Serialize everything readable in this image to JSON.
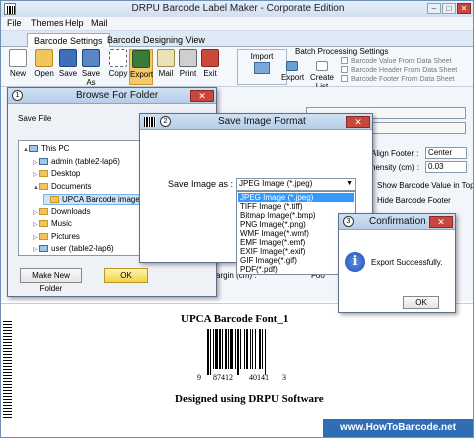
{
  "app": {
    "title": "DRPU Barcode Label Maker - Corporate Edition"
  },
  "menu": [
    "File",
    "Themes",
    "Help",
    "Mail"
  ],
  "tabs": [
    "Barcode Settings",
    "Barcode Designing View"
  ],
  "toolbar": [
    {
      "label": "New",
      "icon": "new-icon"
    },
    {
      "label": "Open",
      "icon": "open-icon"
    },
    {
      "label": "Save",
      "icon": "save-icon"
    },
    {
      "label": "Save As",
      "icon": "save-as-icon"
    },
    {
      "label": "Copy",
      "icon": "copy-icon"
    },
    {
      "label": "Export",
      "icon": "export-icon"
    },
    {
      "label": "Mail",
      "icon": "mail-icon"
    },
    {
      "label": "Print",
      "icon": "print-icon"
    },
    {
      "label": "Exit",
      "icon": "exit-icon"
    }
  ],
  "import": {
    "label": "Import",
    "export_label": "Export",
    "create_list_label": "Create List"
  },
  "batch": {
    "title": "Batch Processing Settings",
    "options": [
      "Barcode Value From Data Sheet",
      "Barcode Header From Data Sheet",
      "Barcode Footer From Data Sheet"
    ]
  },
  "side_fields": {
    "align_footer_label": "Align Footer :",
    "align_footer_value": "Center",
    "margin_label": "hensity (cm) :",
    "margin_value": "0.03",
    "show_value_label": "Show Barcode Value in Top",
    "hide_footer_label": "Hide Barcode Footer",
    "partial_label_1": "in",
    "partial_label_2": "argin (cm) :",
    "partial_label_3": "Foo"
  },
  "browse_dialog": {
    "badge": "1",
    "title": "Browse For Folder",
    "subtitle": "Save File",
    "tree": [
      {
        "label": "This PC",
        "type": "pc",
        "indent": 0,
        "arrow": "▲"
      },
      {
        "label": "admin (table2-lap6)",
        "type": "pc",
        "indent": 1,
        "arrow": "▷"
      },
      {
        "label": "Desktop",
        "type": "folder",
        "indent": 1,
        "arrow": "▷"
      },
      {
        "label": "Documents",
        "type": "folder",
        "indent": 1,
        "arrow": "▲"
      },
      {
        "label": "UPCA Barcode image",
        "type": "folder",
        "indent": 2,
        "arrow": "",
        "selected": true
      },
      {
        "label": "Downloads",
        "type": "folder",
        "indent": 1,
        "arrow": "▷"
      },
      {
        "label": "Music",
        "type": "folder",
        "indent": 1,
        "arrow": "▷"
      },
      {
        "label": "Pictures",
        "type": "folder",
        "indent": 1,
        "arrow": "▷"
      },
      {
        "label": "user (table2-lap6)",
        "type": "pc",
        "indent": 1,
        "arrow": "▷"
      }
    ],
    "new_folder_label": "Make New Folder",
    "ok_label": "OK"
  },
  "save_image_dialog": {
    "badge": "2",
    "title": "Save Image Format",
    "save_as_label": "Save Image as :",
    "selected": "JPEG Image (*.jpeg)",
    "options": [
      "JPEG Image (*.jpeg)",
      "TIFF Image (*.tiff)",
      "Bitmap Image(*.bmp)",
      "PNG Image(*.png)",
      "WMF Image(*.wmf)",
      "EMF Image(*.emf)",
      "EXIF Image(*.exif)",
      "GIF Image(*.gif)",
      "PDF(*.pdf)"
    ]
  },
  "confirm_dialog": {
    "badge": "3",
    "title": "Confirmation",
    "message": "Export Successfully.",
    "ok_label": "OK"
  },
  "canvas": {
    "title": "UPCA Barcode Font_1",
    "digits": [
      "9",
      "87412",
      "40141",
      "3"
    ],
    "footer": "Designed using DRPU Software"
  },
  "brand": "www.HowToBarcode.net"
}
